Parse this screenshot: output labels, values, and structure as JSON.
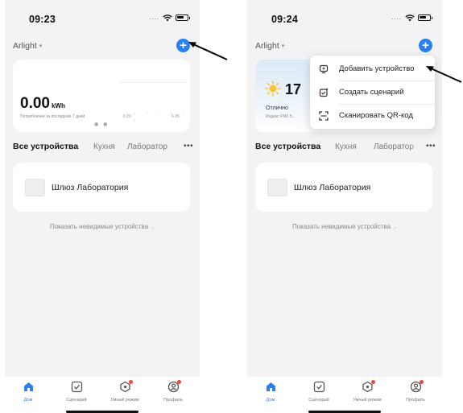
{
  "left_screen": {
    "status_bar": {
      "time": "09:23",
      "signal": "....",
      "icons": [
        "wifi-icon",
        "battery-icon"
      ]
    },
    "header": {
      "home_name": "Arlight",
      "caret": "▾",
      "add_icon": "+"
    },
    "energy_card": {
      "value": "0.00",
      "unit": "kWh",
      "caption": "Потребление за последние 7 дней",
      "chart_ticks": [
        "6.20",
        "6.26"
      ],
      "pager": "● ●"
    },
    "tabs": {
      "active": "Все устройства",
      "items": [
        "Кухня",
        "Лаборатор"
      ],
      "more": "•••"
    },
    "device": {
      "name": "Шлюз Лаборатория"
    },
    "hidden_devices": {
      "label": "Показать невидимые устройства",
      "chevron": "⌄"
    },
    "bottom_nav": [
      {
        "label": "Дом",
        "icon": "home-icon",
        "active": true
      },
      {
        "label": "Сценарий",
        "icon": "scenario-icon",
        "active": false
      },
      {
        "label": "Умный режим",
        "icon": "smart-mode-icon",
        "active": false,
        "badge": true
      },
      {
        "label": "Профиль",
        "icon": "profile-icon",
        "active": false,
        "badge": true
      }
    ]
  },
  "right_screen": {
    "status_bar": {
      "time": "09:24",
      "signal": "....",
      "icons": [
        "wifi-icon",
        "battery-icon"
      ]
    },
    "header": {
      "home_name": "Arlight",
      "caret": "▾",
      "add_icon": "+"
    },
    "weather_card": {
      "temperature": "17",
      "air_quality": "Отлично",
      "air_index": "Индекс PM2.5..."
    },
    "dropdown_menu": [
      {
        "label": "Добавить устройство",
        "icon": "add-device-icon"
      },
      {
        "label": "Создать сценарий",
        "icon": "create-scenario-icon"
      },
      {
        "label": "Сканировать QR-код",
        "icon": "scan-qr-icon"
      }
    ],
    "tabs": {
      "active": "Все устройства",
      "items": [
        "Кухня",
        "Лаборатор"
      ],
      "more": "•••"
    },
    "device": {
      "name": "Шлюз Лаборатория"
    },
    "hidden_devices": {
      "label": "Показать невидимые устройства",
      "chevron": "⌄"
    },
    "bottom_nav": [
      {
        "label": "Дом",
        "icon": "home-icon",
        "active": true
      },
      {
        "label": "Сценарий",
        "icon": "scenario-icon",
        "active": false
      },
      {
        "label": "Умный режим",
        "icon": "smart-mode-icon",
        "active": false,
        "badge": true
      },
      {
        "label": "Профиль",
        "icon": "profile-icon",
        "active": false,
        "badge": true
      }
    ]
  },
  "colors": {
    "accent": "#2a80f2",
    "background": "#f3f3f5",
    "card": "#ffffff",
    "badge": "#f0483e",
    "annotation_arrow": "#000000"
  },
  "annotations": [
    {
      "type": "arrow",
      "target": "add-button",
      "icon": "arrow-icon"
    },
    {
      "type": "arrow",
      "target": "menu-item-add-device",
      "icon": "arrow-icon"
    }
  ]
}
